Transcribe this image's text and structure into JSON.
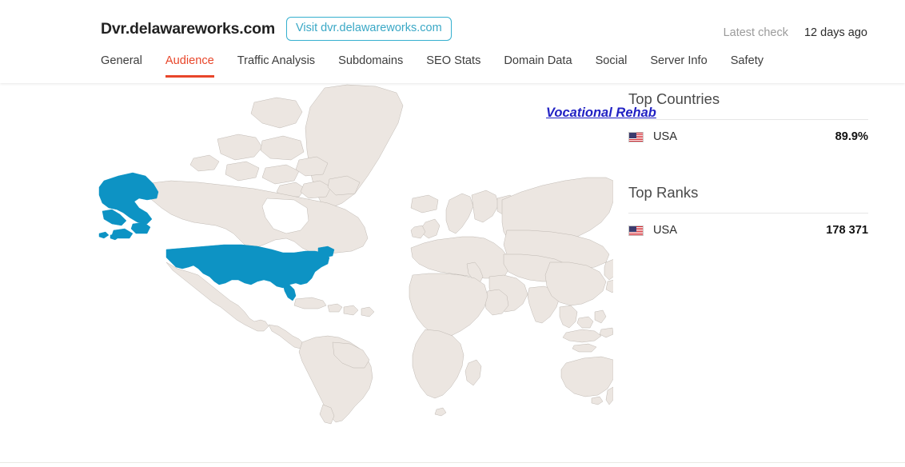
{
  "header": {
    "site_title": "Dvr.delawareworks.com",
    "visit_button": "Visit dvr.delawareworks.com",
    "latest_check_label": "Latest check",
    "latest_check_value": "12 days ago"
  },
  "tabs": [
    {
      "label": "General",
      "active": false
    },
    {
      "label": "Audience",
      "active": true
    },
    {
      "label": "Traffic Analysis",
      "active": false
    },
    {
      "label": "Subdomains",
      "active": false
    },
    {
      "label": "SEO Stats",
      "active": false
    },
    {
      "label": "Domain Data",
      "active": false
    },
    {
      "label": "Social",
      "active": false
    },
    {
      "label": "Server Info",
      "active": false
    },
    {
      "label": "Safety",
      "active": false
    }
  ],
  "map": {
    "label": "Vocational Rehab",
    "highlighted_countries": [
      "USA"
    ],
    "highlight_color": "#0d93c4",
    "land_color": "#ece6e1",
    "border_color": "#b9b2ab"
  },
  "panels": [
    {
      "heading": "Top Countries",
      "rows": [
        {
          "flag": "us-flag-icon",
          "label": "USA",
          "value": "89.9%"
        }
      ]
    },
    {
      "heading": "Top Ranks",
      "rows": [
        {
          "flag": "us-flag-icon",
          "label": "USA",
          "value": "178 371"
        }
      ]
    }
  ],
  "theme": {
    "accent": "#e8462a",
    "link_teal": "#3aa8c6",
    "map_blue": "#0d93c4",
    "map_label_color": "#2222c4"
  }
}
